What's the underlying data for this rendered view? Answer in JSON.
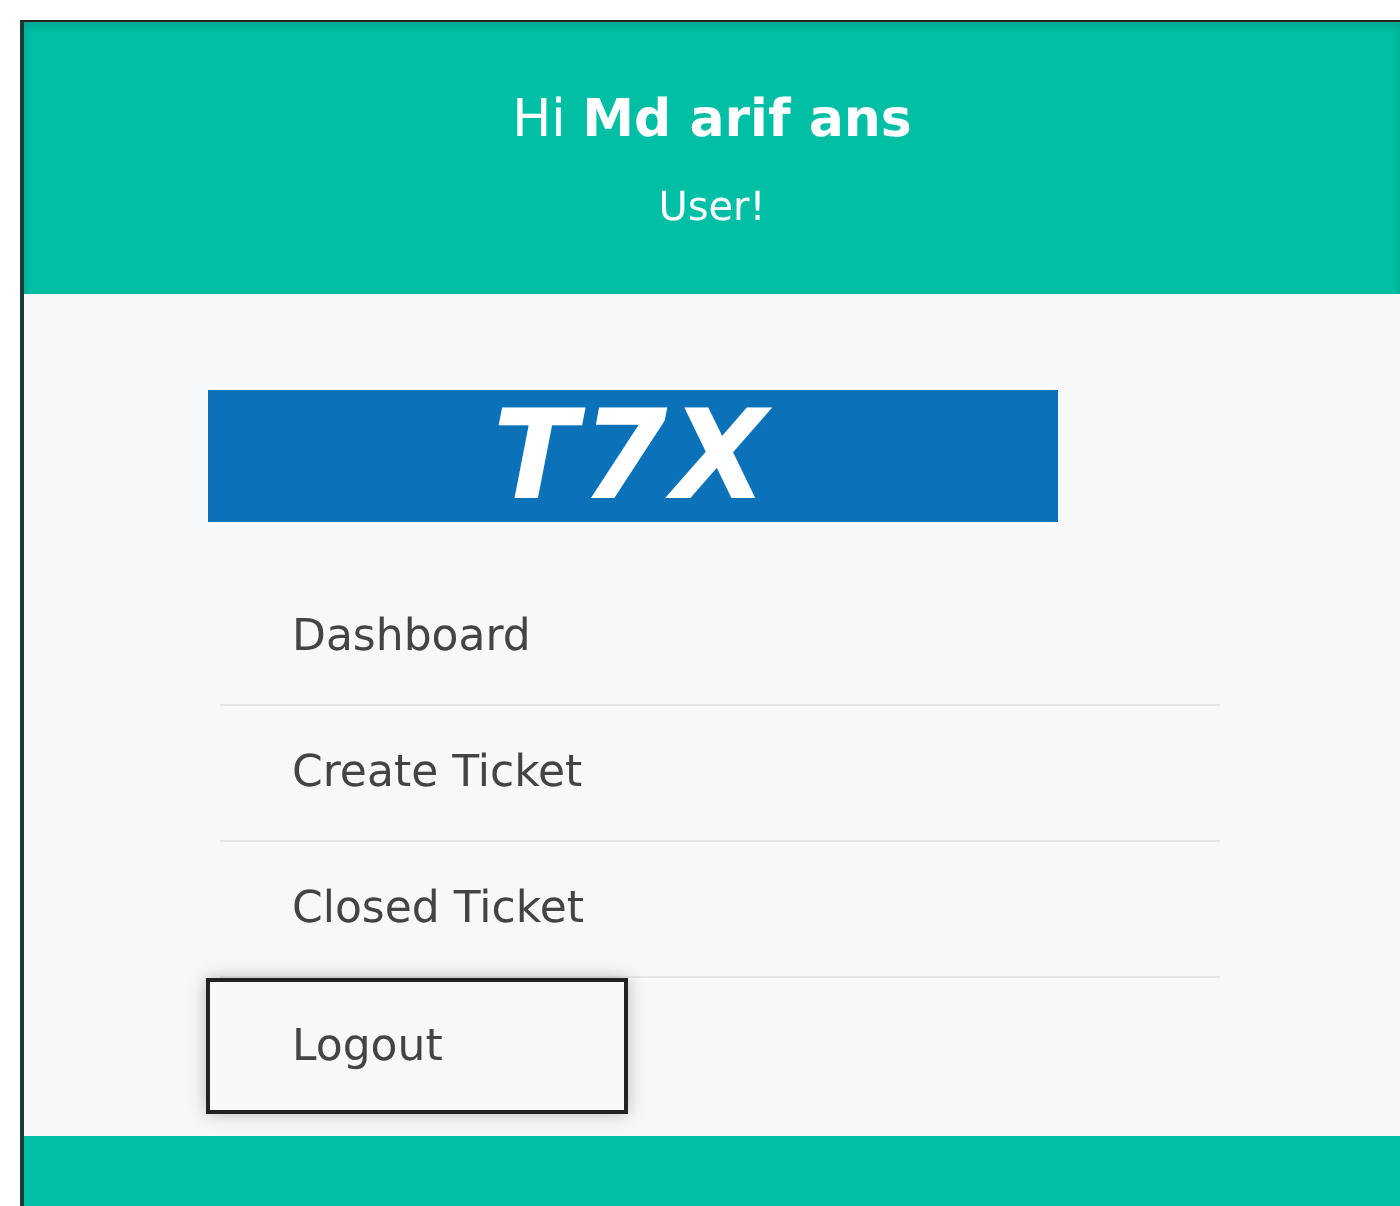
{
  "header": {
    "greeting": "Hi **Md arif ans**",
    "role": "User!"
  },
  "logo": {
    "text": "T7X"
  },
  "menu": [
    {
      "label": "Dashboard",
      "highlighted": false
    },
    {
      "label": "Create Ticket",
      "highlighted": false
    },
    {
      "label": "Closed Ticket",
      "highlighted": false
    },
    {
      "label": "Logout",
      "highlighted": true
    }
  ]
}
